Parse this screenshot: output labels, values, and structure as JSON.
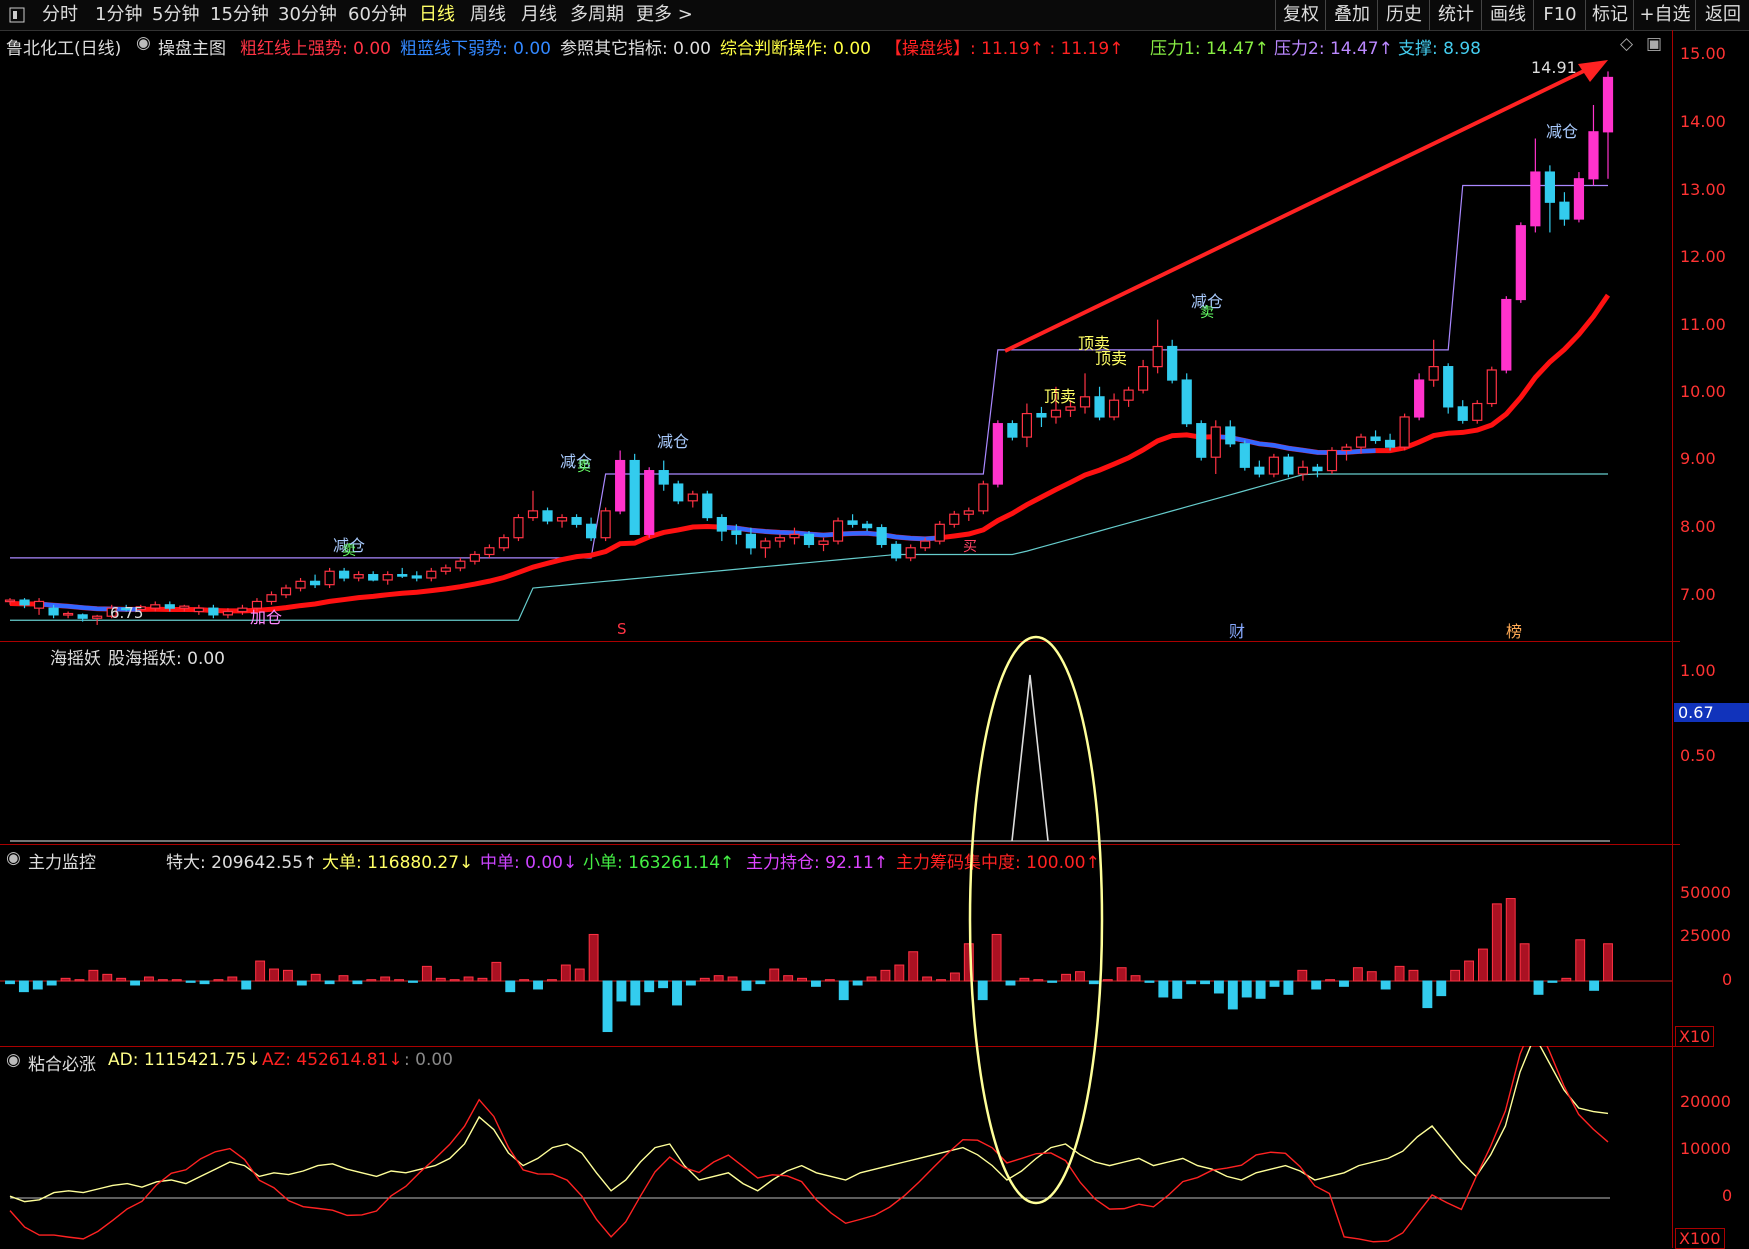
{
  "toolbar": {
    "tabs": [
      "分时",
      "1分钟",
      "5分钟",
      "15分钟",
      "30分钟",
      "60分钟",
      "日线",
      "周线",
      "月线",
      "多周期",
      "更多 >"
    ],
    "active_tab": "日线",
    "right_buttons": [
      "复权",
      "叠加",
      "历史",
      "统计",
      "画线",
      "F10",
      "标记",
      "+自选",
      "返回"
    ]
  },
  "main_panel": {
    "stock_title": "鲁北化工(日线)",
    "indicator_name": "操盘主图",
    "red_strong": "粗红线上强势: 0.00",
    "blue_weak": "粗蓝线下弱势: 0.00",
    "ref_other": "参照其它指标: 0.00",
    "composite": "综合判断操作: 0.00",
    "trade_line": "【操盘线】: 11.19↑ : 11.19↑",
    "pressure1": "压力1: 14.47↑",
    "pressure2": "压力2: 14.47↑",
    "support": "支撑: 8.98",
    "high_label": "14.91",
    "low_label": "6.75",
    "marks": [
      "减仓",
      "减仓",
      "减仓",
      "减仓",
      "减仓",
      "加仓",
      "顶卖",
      "顶卖",
      "顶卖",
      "卖",
      "卖",
      "卖",
      "买",
      "S",
      "财",
      "榜"
    ],
    "y_ticks": [
      "15.00",
      "14.00",
      "13.00",
      "12.00",
      "11.00",
      "10.00",
      "9.00",
      "8.00",
      "7.00"
    ]
  },
  "panel2": {
    "title": "海摇妖",
    "value": "股海摇妖: 0.00",
    "y_ticks": [
      "1.00",
      "0.50"
    ],
    "current_label": "0.67"
  },
  "panel3": {
    "title": "主力监控",
    "super_large": "特大: 209642.55↑",
    "large": "大单: 116880.27↓",
    "medium": "中单: 0.00↓",
    "small": "小单: 163261.14↑",
    "holding": "主力持仓: 92.11↑",
    "concentration": "主力筹码集中度: 100.00↑",
    "y_ticks": [
      "50000",
      "25000",
      "0"
    ],
    "unit": "X10"
  },
  "panel4": {
    "title": "粘合必涨",
    "ad": "AD: 1115421.75↓",
    "az": "AZ: 452614.81↓",
    "extra": ": 0.00",
    "y_ticks": [
      "20000",
      "10000",
      "0"
    ],
    "unit": "X100"
  },
  "colors": {
    "up": "#ff3344",
    "down": "#33ccee",
    "ma_red": "#ff1111",
    "ma_blue": "#3366ff",
    "pressure": "#aa88ff",
    "support": "#66cccc",
    "highlight_ellipse": "#ffff99",
    "axis": "#ff3333"
  },
  "chart_data": {
    "type": "candlestick",
    "ylim": [
      6.6,
      15.2
    ],
    "candles": [
      [
        7.1,
        7.15,
        7.05,
        7.12
      ],
      [
        7.12,
        7.15,
        7.0,
        7.05
      ],
      [
        7.0,
        7.15,
        6.9,
        7.1
      ],
      [
        7.0,
        7.05,
        6.85,
        6.9
      ],
      [
        6.9,
        6.95,
        6.85,
        6.92
      ],
      [
        6.9,
        6.92,
        6.8,
        6.85
      ],
      [
        6.85,
        6.9,
        6.75,
        6.88
      ],
      [
        6.88,
        7.05,
        6.85,
        7.0
      ],
      [
        7.0,
        7.05,
        6.95,
        6.98
      ],
      [
        6.98,
        7.05,
        6.95,
        7.02
      ],
      [
        7.0,
        7.1,
        6.95,
        7.05
      ],
      [
        7.05,
        7.1,
        6.95,
        7.0
      ],
      [
        7.0,
        7.05,
        6.95,
        7.03
      ],
      [
        6.95,
        7.05,
        6.9,
        7.0
      ],
      [
        7.0,
        7.05,
        6.85,
        6.9
      ],
      [
        6.9,
        7.0,
        6.85,
        6.95
      ],
      [
        6.95,
        7.05,
        6.9,
        7.0
      ],
      [
        7.0,
        7.15,
        6.95,
        7.1
      ],
      [
        7.1,
        7.25,
        7.05,
        7.2
      ],
      [
        7.2,
        7.35,
        7.15,
        7.3
      ],
      [
        7.3,
        7.45,
        7.25,
        7.4
      ],
      [
        7.4,
        7.5,
        7.3,
        7.35
      ],
      [
        7.35,
        7.6,
        7.3,
        7.55
      ],
      [
        7.55,
        7.6,
        7.4,
        7.45
      ],
      [
        7.45,
        7.55,
        7.4,
        7.5
      ],
      [
        7.5,
        7.55,
        7.4,
        7.42
      ],
      [
        7.42,
        7.55,
        7.35,
        7.5
      ],
      [
        7.5,
        7.6,
        7.45,
        7.48
      ],
      [
        7.48,
        7.55,
        7.4,
        7.45
      ],
      [
        7.45,
        7.6,
        7.4,
        7.55
      ],
      [
        7.55,
        7.65,
        7.5,
        7.6
      ],
      [
        7.6,
        7.75,
        7.55,
        7.7
      ],
      [
        7.7,
        7.85,
        7.65,
        7.8
      ],
      [
        7.8,
        7.95,
        7.75,
        7.9
      ],
      [
        7.9,
        8.1,
        7.85,
        8.05
      ],
      [
        8.05,
        8.4,
        8.0,
        8.35
      ],
      [
        8.35,
        8.75,
        8.3,
        8.45
      ],
      [
        8.45,
        8.5,
        8.25,
        8.3
      ],
      [
        8.3,
        8.4,
        8.2,
        8.35
      ],
      [
        8.35,
        8.4,
        8.2,
        8.25
      ],
      [
        8.25,
        8.35,
        8.0,
        8.05
      ],
      [
        8.05,
        8.5,
        8.0,
        8.45
      ],
      [
        8.45,
        9.35,
        8.4,
        9.2
      ],
      [
        9.2,
        9.3,
        8.1,
        8.1
      ],
      [
        8.1,
        9.1,
        8.05,
        9.05
      ],
      [
        9.05,
        9.2,
        8.75,
        8.85
      ],
      [
        8.85,
        8.9,
        8.55,
        8.6
      ],
      [
        8.6,
        8.75,
        8.5,
        8.7
      ],
      [
        8.7,
        8.75,
        8.3,
        8.35
      ],
      [
        8.35,
        8.4,
        8.0,
        8.15
      ],
      [
        8.15,
        8.25,
        7.95,
        8.1
      ],
      [
        8.1,
        8.2,
        7.8,
        7.9
      ],
      [
        7.9,
        8.05,
        7.75,
        8.0
      ],
      [
        8.0,
        8.1,
        7.9,
        8.05
      ],
      [
        8.05,
        8.2,
        7.95,
        8.1
      ],
      [
        8.1,
        8.15,
        7.9,
        7.95
      ],
      [
        7.95,
        8.05,
        7.85,
        8.0
      ],
      [
        8.0,
        8.35,
        7.95,
        8.3
      ],
      [
        8.3,
        8.4,
        8.2,
        8.25
      ],
      [
        8.25,
        8.3,
        8.15,
        8.2
      ],
      [
        8.2,
        8.25,
        7.9,
        7.95
      ],
      [
        7.95,
        8.0,
        7.7,
        7.75
      ],
      [
        7.75,
        7.95,
        7.7,
        7.9
      ],
      [
        7.9,
        8.05,
        7.85,
        8.0
      ],
      [
        8.0,
        8.3,
        7.95,
        8.25
      ],
      [
        8.25,
        8.45,
        8.2,
        8.4
      ],
      [
        8.4,
        8.5,
        8.3,
        8.45
      ],
      [
        8.45,
        8.9,
        8.4,
        8.85
      ],
      [
        8.85,
        9.8,
        8.8,
        9.75
      ],
      [
        9.75,
        9.8,
        9.5,
        9.55
      ],
      [
        9.55,
        10.05,
        9.4,
        9.9
      ],
      [
        9.9,
        10.0,
        9.7,
        9.85
      ],
      [
        9.85,
        10.3,
        9.75,
        9.95
      ],
      [
        9.95,
        10.1,
        9.85,
        10.0
      ],
      [
        10.0,
        10.5,
        9.9,
        10.15
      ],
      [
        10.15,
        10.3,
        9.8,
        9.85
      ],
      [
        9.85,
        10.2,
        9.8,
        10.1
      ],
      [
        10.1,
        10.3,
        10.0,
        10.25
      ],
      [
        10.25,
        10.7,
        10.2,
        10.6
      ],
      [
        10.6,
        11.3,
        10.5,
        10.9
      ],
      [
        10.9,
        11.0,
        10.35,
        10.4
      ],
      [
        10.4,
        10.5,
        9.7,
        9.75
      ],
      [
        9.75,
        9.8,
        9.2,
        9.25
      ],
      [
        9.25,
        9.8,
        9.0,
        9.7
      ],
      [
        9.7,
        9.8,
        9.4,
        9.45
      ],
      [
        9.45,
        9.5,
        9.05,
        9.1
      ],
      [
        9.1,
        9.2,
        8.95,
        9.0
      ],
      [
        9.0,
        9.3,
        8.95,
        9.25
      ],
      [
        9.25,
        9.3,
        8.95,
        9.0
      ],
      [
        9.0,
        9.2,
        8.9,
        9.1
      ],
      [
        9.1,
        9.15,
        8.95,
        9.05
      ],
      [
        9.05,
        9.4,
        9.0,
        9.35
      ],
      [
        9.35,
        9.45,
        9.2,
        9.4
      ],
      [
        9.4,
        9.6,
        9.3,
        9.55
      ],
      [
        9.55,
        9.65,
        9.45,
        9.5
      ],
      [
        9.5,
        9.6,
        9.35,
        9.4
      ],
      [
        9.4,
        9.9,
        9.35,
        9.85
      ],
      [
        9.85,
        10.5,
        9.8,
        10.4
      ],
      [
        10.4,
        11.0,
        10.3,
        10.6
      ],
      [
        10.6,
        10.65,
        9.9,
        10.0
      ],
      [
        10.0,
        10.1,
        9.75,
        9.8
      ],
      [
        9.8,
        10.1,
        9.75,
        10.05
      ],
      [
        10.05,
        10.6,
        10.0,
        10.55
      ],
      [
        10.55,
        11.65,
        10.5,
        11.6
      ],
      [
        11.6,
        12.75,
        11.55,
        12.7
      ],
      [
        12.7,
        14.0,
        12.6,
        13.5
      ],
      [
        13.5,
        13.6,
        12.6,
        13.05
      ],
      [
        13.05,
        13.2,
        12.7,
        12.8
      ],
      [
        12.8,
        13.5,
        12.75,
        13.4
      ],
      [
        13.4,
        14.5,
        13.3,
        14.1
      ],
      [
        14.1,
        15.0,
        13.4,
        14.91
      ]
    ]
  }
}
